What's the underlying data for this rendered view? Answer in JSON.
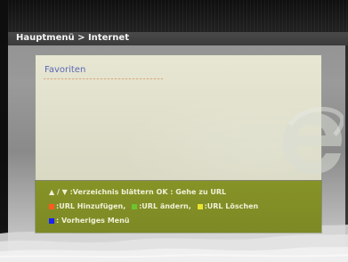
{
  "header": {
    "breadcrumb": "Hauptmenü > Internet"
  },
  "favorites": {
    "title": "Favoriten"
  },
  "help": {
    "line1": "▲ / ▼ :Verzeichnis blättern OK : Gehe zu URL",
    "line2_add": ":URL Hinzufügen,",
    "line2_edit": ":URL ändern,",
    "line2_delete": ":URL Löschen",
    "line3": ": Vorheriges Menü"
  },
  "colors": {
    "red": "#ff5a1f",
    "green": "#6cc52f",
    "yellow": "#e8e42f",
    "blue": "#1a22ff"
  }
}
